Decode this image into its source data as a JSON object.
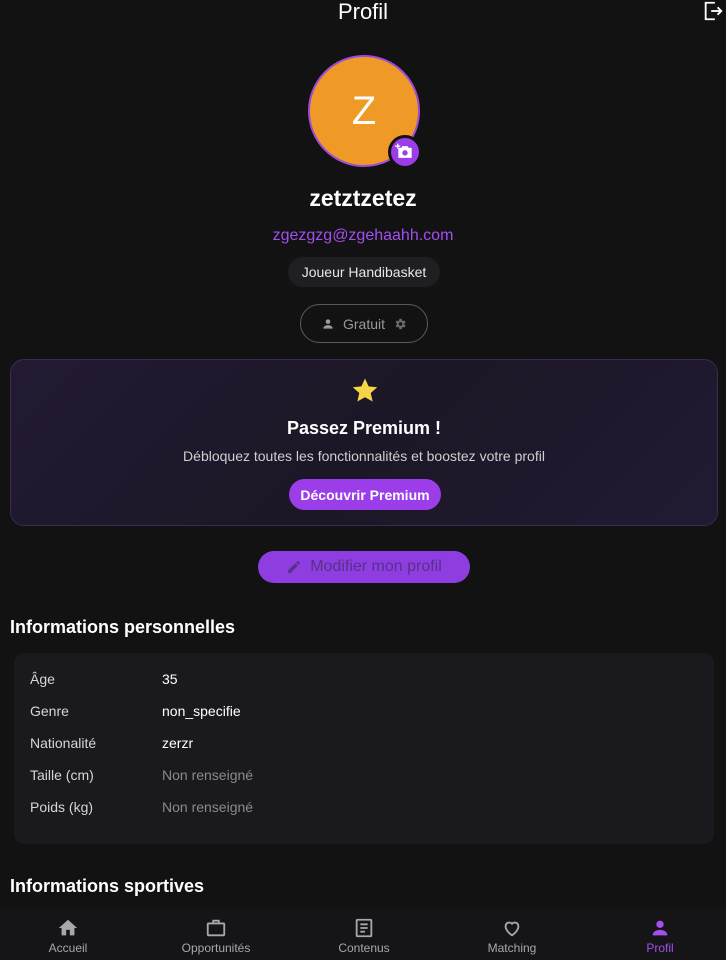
{
  "header": {
    "title": "Profil",
    "logout_icon": "logout-icon"
  },
  "profile": {
    "initial": "Z",
    "username": "zetztzetez",
    "email": "zgezgzg@zgehaahh.com",
    "role": "Joueur Handibasket",
    "plan": "Gratuit",
    "avatar_color": "#ef9a27",
    "accent_color": "#9b3de8"
  },
  "premium": {
    "title": "Passez Premium !",
    "subtitle": "Débloquez toutes les fonctionnalités et boostez votre profil",
    "button": "Découvrir Premium"
  },
  "edit_button": "Modifier mon profil",
  "personal": {
    "title": "Informations personnelles",
    "rows": [
      {
        "label": "Âge",
        "value": "35"
      },
      {
        "label": "Genre",
        "value": "non_specifie"
      },
      {
        "label": "Nationalité",
        "value": "zerzr"
      },
      {
        "label": "Taille (cm)",
        "value": "Non renseigné"
      },
      {
        "label": "Poids (kg)",
        "value": "Non renseigné"
      }
    ]
  },
  "sports": {
    "title": "Informations sportives"
  },
  "nav": {
    "items": [
      {
        "label": "Accueil",
        "icon": "home-icon"
      },
      {
        "label": "Opportunités",
        "icon": "briefcase-icon"
      },
      {
        "label": "Contenus",
        "icon": "article-icon"
      },
      {
        "label": "Matching",
        "icon": "heart-icon"
      },
      {
        "label": "Profil",
        "icon": "person-icon",
        "active": true
      }
    ]
  }
}
